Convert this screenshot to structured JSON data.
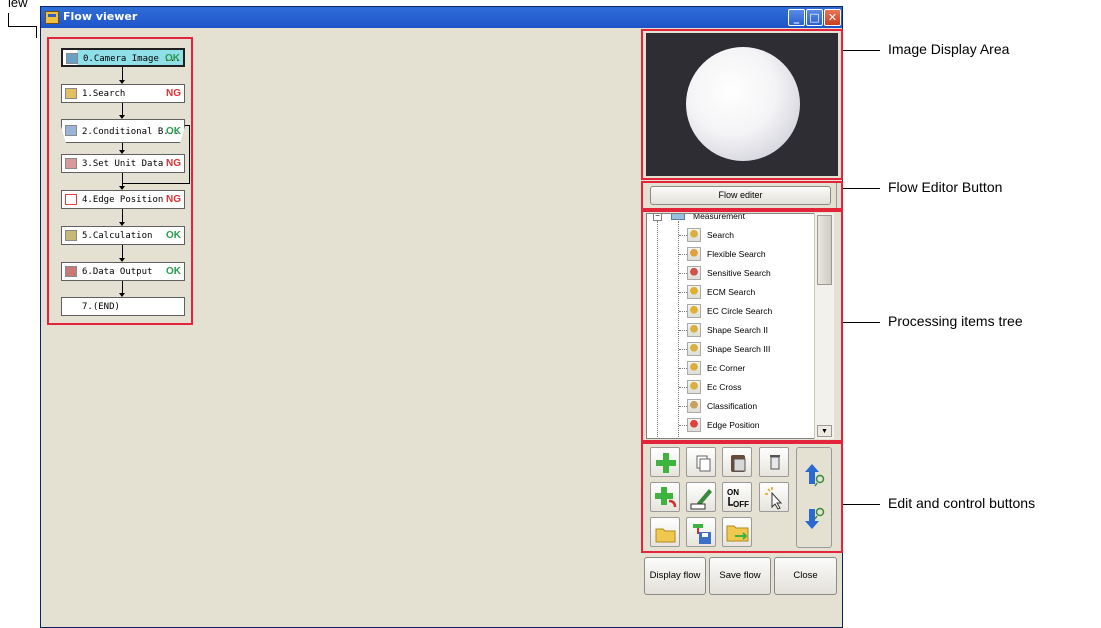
{
  "window": {
    "title": "Flow viewer"
  },
  "left_label_fragment": "iew",
  "flow_nodes": [
    {
      "label": "0.Camera Image ...",
      "status": "OK",
      "status_class": "ok"
    },
    {
      "label": "1.Search",
      "status": "NG",
      "status_class": "ng"
    },
    {
      "label": "2.Conditional B...",
      "status": "OK",
      "status_class": "ok"
    },
    {
      "label": "3.Set Unit Data",
      "status": "NG",
      "status_class": "ng"
    },
    {
      "label": "4.Edge Position",
      "status": "NG",
      "status_class": "ng"
    },
    {
      "label": "5.Calculation",
      "status": "OK",
      "status_class": "ok"
    },
    {
      "label": "6.Data Output",
      "status": "OK",
      "status_class": "ok"
    },
    {
      "label": "7.(END)",
      "status": "",
      "status_class": ""
    }
  ],
  "flow_editor_button": "Flow editer",
  "tree": {
    "root": "Measurement",
    "items": [
      "Search",
      "Flexible Search",
      "Sensitive Search",
      "ECM Search",
      "EC Circle Search",
      "Shape Search II",
      "Shape Search III",
      "Ec Corner",
      "Ec Cross",
      "Classification",
      "Edge Position"
    ]
  },
  "bottom_buttons": {
    "display_flow": "Display flow",
    "save_flow": "Save flow",
    "close": "Close"
  },
  "callouts": {
    "image_display_area": "Image Display Area",
    "flow_editor_button": "Flow Editor Button",
    "processing_items_tree": "Processing items tree",
    "edit_control_buttons": "Edit and control buttons"
  },
  "colors": {
    "highlight": "#e2253a",
    "ok": "#2a9a4a",
    "ng": "#e03030",
    "window_bg": "#e4e1d2",
    "titlebar": "#1f53c8"
  },
  "icons": [
    "add-icon",
    "copy-icon",
    "paste-icon",
    "delete-icon",
    "insert-icon",
    "rename-icon",
    "on-off-icon",
    "select-icon",
    "open-icon",
    "save-icon",
    "folder-transfer-icon",
    "move-up-icon",
    "move-down-icon"
  ]
}
